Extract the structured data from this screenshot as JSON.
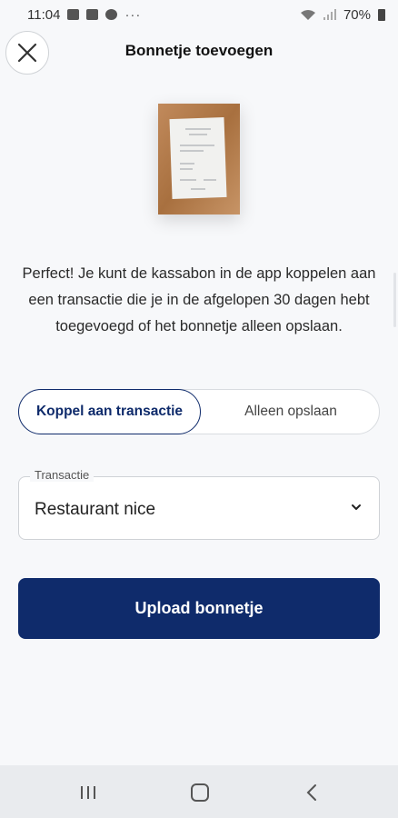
{
  "status_bar": {
    "time": "11:04",
    "dots": "···",
    "battery": "70%"
  },
  "header": {
    "title": "Bonnetje toevoegen",
    "close_icon": "close-icon"
  },
  "receipt": {
    "image": "receipt-photo"
  },
  "info": {
    "text": "Perfect! Je kunt de kassabon in de app koppelen aan een transactie die je in de afgelopen 30 dagen hebt toegevoegd of het bonnetje alleen opslaan."
  },
  "segmented": {
    "option_link": "Koppel aan transactie",
    "option_save": "Alleen opslaan",
    "selected": "Koppel aan transactie"
  },
  "transaction_select": {
    "label": "Transactie",
    "value": "Restaurant nice",
    "icon": "chevron-down-icon"
  },
  "actions": {
    "upload_label": "Upload bonnetje"
  },
  "colors": {
    "primary": "#0f2b6b",
    "background": "#f7f8fa",
    "border": "#cfd2d6"
  }
}
